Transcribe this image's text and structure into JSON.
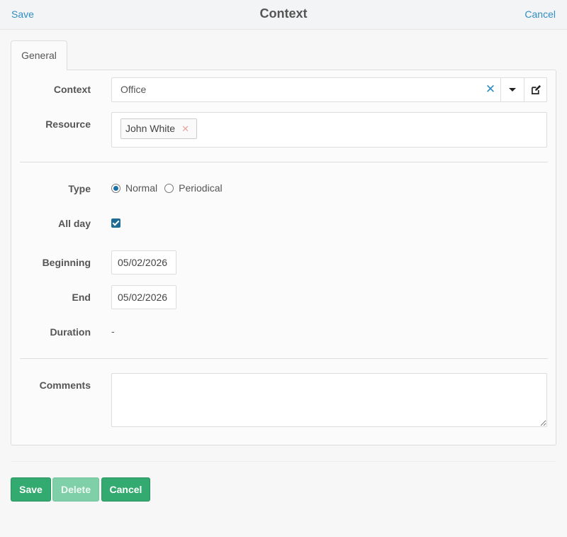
{
  "header": {
    "save_label": "Save",
    "title": "Context",
    "cancel_label": "Cancel"
  },
  "tabs": [
    {
      "label": "General",
      "active": true
    }
  ],
  "form": {
    "context": {
      "label": "Context",
      "value": "Office"
    },
    "resource": {
      "label": "Resource",
      "tags": [
        "John White"
      ]
    },
    "type": {
      "label": "Type",
      "options": [
        {
          "label": "Normal",
          "selected": true
        },
        {
          "label": "Periodical",
          "selected": false
        }
      ]
    },
    "all_day": {
      "label": "All day",
      "checked": true
    },
    "beginning": {
      "label": "Beginning",
      "value": "05/02/2026"
    },
    "end": {
      "label": "End",
      "value": "05/02/2026"
    },
    "duration": {
      "label": "Duration",
      "value": "-"
    },
    "comments": {
      "label": "Comments",
      "value": ""
    }
  },
  "footer": {
    "save_label": "Save",
    "delete_label": "Delete",
    "cancel_label": "Cancel"
  },
  "colors": {
    "link": "#2f8ec2",
    "primary_button": "#33aa6f",
    "disabled_button": "#7fcfa8",
    "radio_checked": "#1a6fa5",
    "checkbox_checked": "#1e6b93"
  },
  "icons": [
    "clear-icon",
    "chevron-down-icon",
    "edit-icon",
    "remove-tag-icon"
  ]
}
